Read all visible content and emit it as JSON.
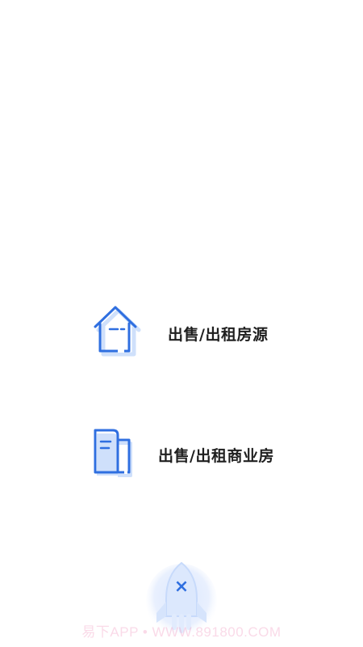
{
  "menu": {
    "options": [
      {
        "label": "出售/出租房源",
        "icon": "house-icon"
      },
      {
        "label": "出售/出租商业房",
        "icon": "building-document-icon"
      }
    ]
  },
  "close_button": {
    "icon": "close-icon",
    "glyph": "×",
    "background_icon": "rocket-icon"
  },
  "watermark": {
    "text": "易下APP • WWW.891800.COM"
  },
  "colors": {
    "accent": "#2f6fe0",
    "icon_shadow": "#cfe0fb",
    "label_text": "#1f1f1f",
    "background": "#ffffff",
    "watermark": "#f296be"
  }
}
